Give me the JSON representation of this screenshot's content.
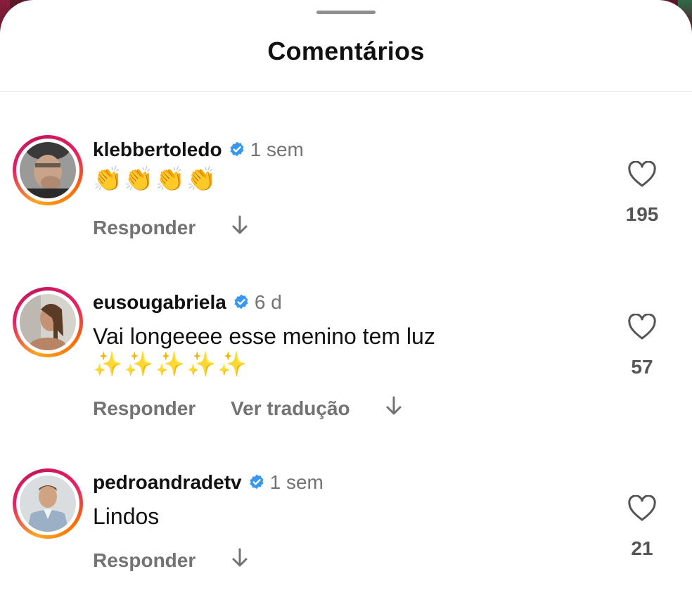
{
  "header": {
    "title": "Comentários"
  },
  "comments": [
    {
      "username": "klebbertoledo",
      "time": "1 sem",
      "text": "",
      "emojis": "👏👏👏👏",
      "reply_label": "Responder",
      "translate_label": "",
      "likes": "195"
    },
    {
      "username": "eusougabriela",
      "time": "6 d",
      "text": "Vai longeeee esse menino tem luz",
      "emojis": "✨✨✨✨✨",
      "reply_label": "Responder",
      "translate_label": "Ver tradução",
      "likes": "57"
    },
    {
      "username": "pedroandradetv",
      "time": "1 sem",
      "text": "Lindos",
      "emojis": "",
      "reply_label": "Responder",
      "translate_label": "",
      "likes": "21"
    }
  ],
  "icons": {
    "verified": "verified-badge-icon",
    "like": "heart-icon",
    "more": "arrow-down-icon"
  },
  "colors": {
    "verified_blue": "#3897f0",
    "muted_text": "#737373",
    "ring_start": "#f9a825",
    "ring_end": "#e91e63"
  }
}
